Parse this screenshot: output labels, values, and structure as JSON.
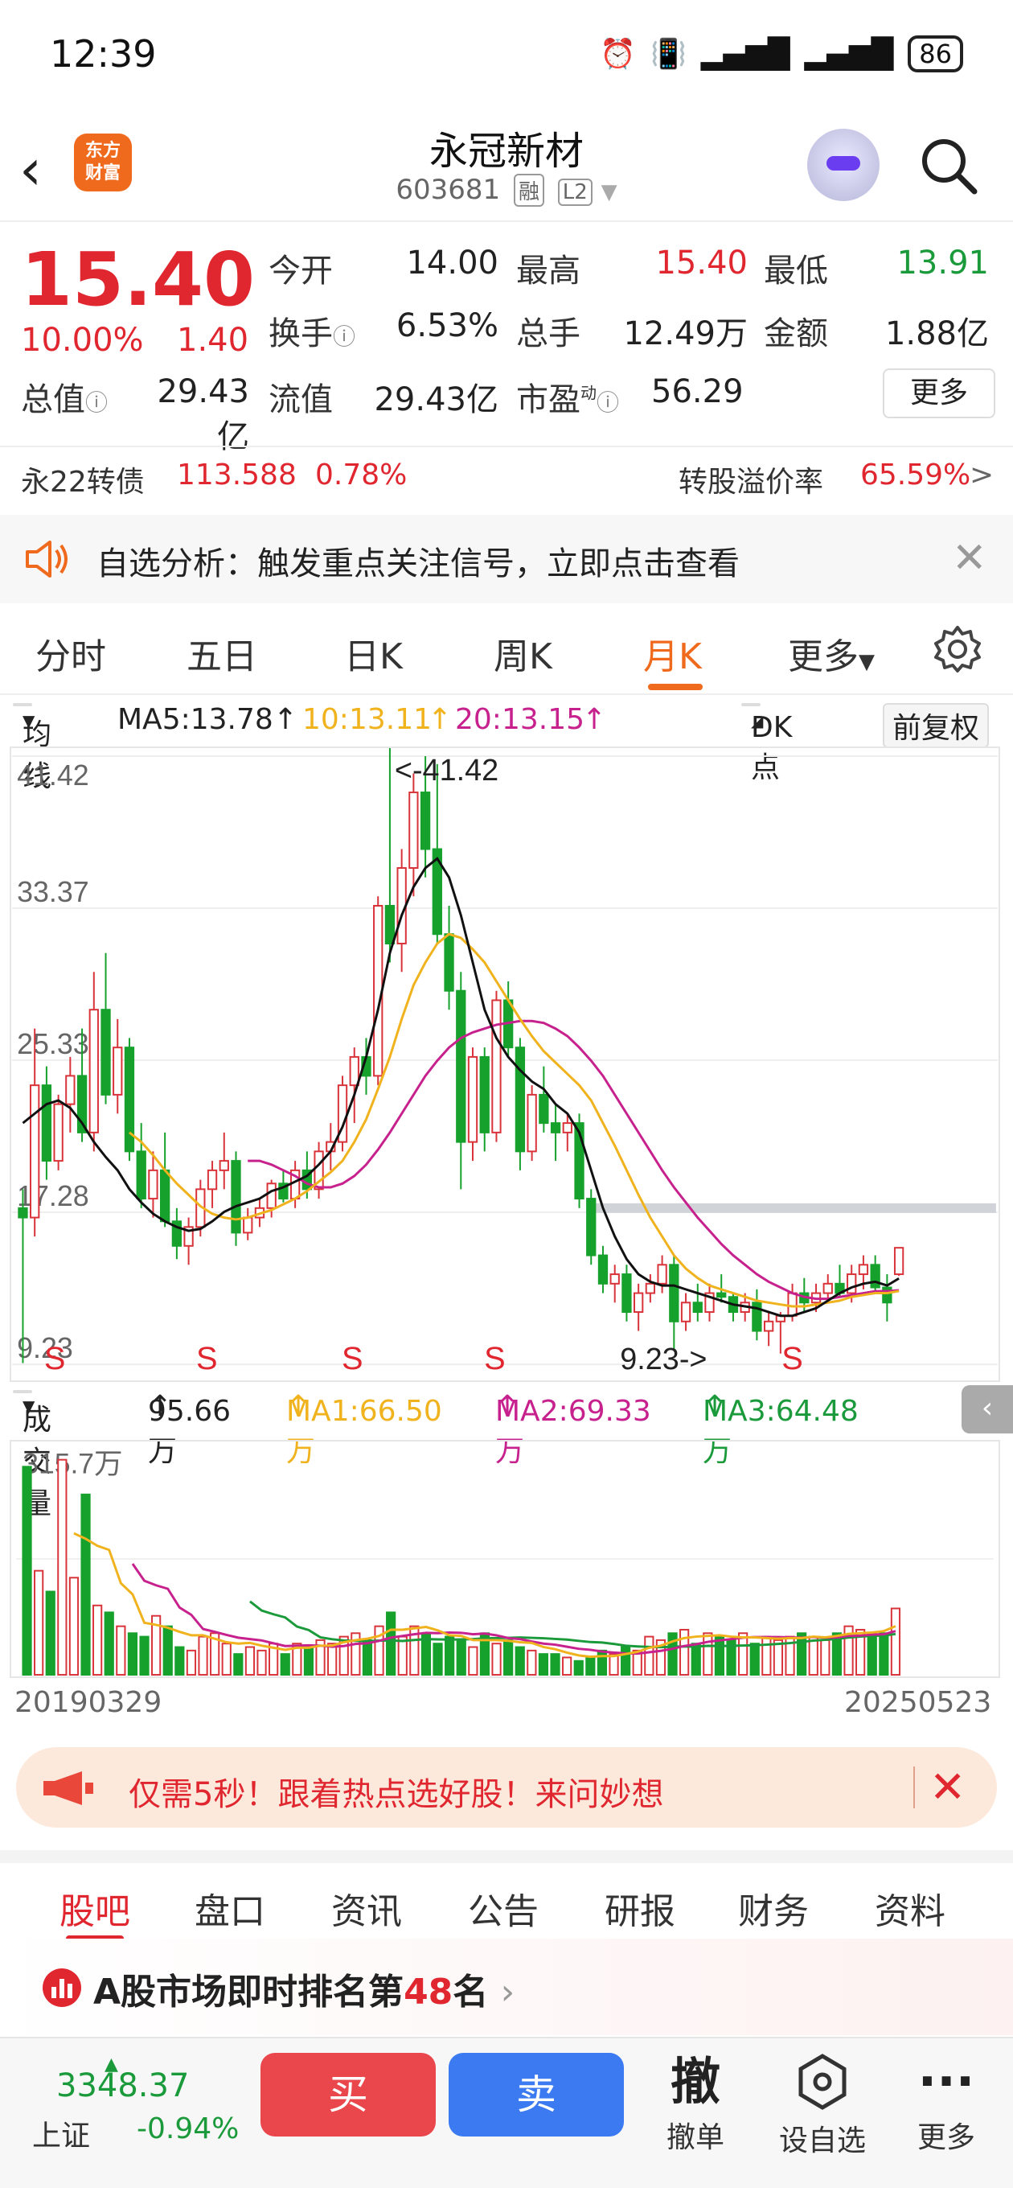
{
  "status": {
    "time": "12:39",
    "battery": "86"
  },
  "header": {
    "name": "永冠新材",
    "code": "603681",
    "tag1": "融",
    "tag2": "L2",
    "logo_line1": "东方",
    "logo_line2": "财富"
  },
  "quote": {
    "price": "15.40",
    "pct": "10.00%",
    "chg": "1.40",
    "open_label": "今开",
    "open": "14.00",
    "high_label": "最高",
    "high": "15.40",
    "low_label": "最低",
    "low": "13.91",
    "turnover_label": "换手",
    "turnover": "6.53%",
    "volume_label": "总手",
    "volume": "12.49万",
    "amount_label": "金额",
    "amount": "1.88亿",
    "mcap_label": "总值",
    "mcap": "29.43亿",
    "float_label": "流值",
    "float": "29.43亿",
    "pe_label": "市盈",
    "pe_sup": "动",
    "pe": "56.29",
    "more": "更多"
  },
  "bond": {
    "name": "永22转债",
    "price": "113.588",
    "pct": "0.78%",
    "premium_label": "转股溢价率",
    "premium": "65.59%"
  },
  "alert": {
    "text": "自选分析：触发重点关注信号，立即点击查看"
  },
  "tabs": [
    "分时",
    "五日",
    "日K",
    "周K",
    "月K",
    "更多"
  ],
  "ma": {
    "selector": "均线",
    "ma5": "MA5:13.78",
    "ma10": "10:13.11",
    "ma20": "20:13.15",
    "dk": "DK点",
    "fq": "前复权"
  },
  "chart_data": {
    "type": "candlestick",
    "y_ticks": [
      "41.42",
      "33.37",
      "25.33",
      "17.28",
      "9.23"
    ],
    "ylim": [
      9.23,
      41.42
    ],
    "annotation_high": "<-41.42",
    "annotation_low": "9.23->",
    "signal_label": "S",
    "candles": [
      [
        17.5,
        18.5,
        9.3,
        17.0
      ],
      [
        17.0,
        27.0,
        16.0,
        24.0
      ],
      [
        24.0,
        25.0,
        19.0,
        20.0
      ],
      [
        20.0,
        23.5,
        19.5,
        23.0
      ],
      [
        23.0,
        25.5,
        21.5,
        24.5
      ],
      [
        24.5,
        27.0,
        21.0,
        21.5
      ],
      [
        21.5,
        30.0,
        20.5,
        28.0
      ],
      [
        28.0,
        31.0,
        23.0,
        23.5
      ],
      [
        23.5,
        27.5,
        22.5,
        26.0
      ],
      [
        26.0,
        26.5,
        20.0,
        20.5
      ],
      [
        20.5,
        22.0,
        17.5,
        18.0
      ],
      [
        18.0,
        20.5,
        17.0,
        19.5
      ],
      [
        19.5,
        21.5,
        16.5,
        16.8
      ],
      [
        16.8,
        17.5,
        14.8,
        15.5
      ],
      [
        15.5,
        17.0,
        14.5,
        16.5
      ],
      [
        16.5,
        19.0,
        16.0,
        18.5
      ],
      [
        18.5,
        20.0,
        17.5,
        19.5
      ],
      [
        19.5,
        21.5,
        18.5,
        20.0
      ],
      [
        20.0,
        20.5,
        15.5,
        16.2
      ],
      [
        16.2,
        17.5,
        15.8,
        17.0
      ],
      [
        17.0,
        18.0,
        16.5,
        17.5
      ],
      [
        17.5,
        19.0,
        17.0,
        18.8
      ],
      [
        18.8,
        19.5,
        17.8,
        18.0
      ],
      [
        18.0,
        20.0,
        17.5,
        19.5
      ],
      [
        19.5,
        20.5,
        18.0,
        18.5
      ],
      [
        18.5,
        21.0,
        18.0,
        20.5
      ],
      [
        20.5,
        22.0,
        19.5,
        21.0
      ],
      [
        21.0,
        24.5,
        20.5,
        24.0
      ],
      [
        24.0,
        26.0,
        22.0,
        25.5
      ],
      [
        25.5,
        26.5,
        23.5,
        24.5
      ],
      [
        24.5,
        34.0,
        24.0,
        33.5
      ],
      [
        33.5,
        42.0,
        30.5,
        31.5
      ],
      [
        31.5,
        36.5,
        30.0,
        35.5
      ],
      [
        35.5,
        40.5,
        34.0,
        39.5
      ],
      [
        39.5,
        41.42,
        35.0,
        36.5
      ],
      [
        36.5,
        41.0,
        31.5,
        32.0
      ],
      [
        32.0,
        33.5,
        28.0,
        29.0
      ],
      [
        29.0,
        30.0,
        18.5,
        21.0
      ],
      [
        21.0,
        26.0,
        20.0,
        25.5
      ],
      [
        25.5,
        26.0,
        20.5,
        21.5
      ],
      [
        21.5,
        29.0,
        21.0,
        28.5
      ],
      [
        28.5,
        29.5,
        25.5,
        26.0
      ],
      [
        26.0,
        26.5,
        19.5,
        20.5
      ],
      [
        20.5,
        24.0,
        20.0,
        23.5
      ],
      [
        23.5,
        25.0,
        21.5,
        22.0
      ],
      [
        22.0,
        23.0,
        20.0,
        21.5
      ],
      [
        21.5,
        22.5,
        20.5,
        22.0
      ],
      [
        22.0,
        22.5,
        17.5,
        18.0
      ],
      [
        18.0,
        18.5,
        14.5,
        15.0
      ],
      [
        15.0,
        15.5,
        13.0,
        13.5
      ],
      [
        13.5,
        14.5,
        12.5,
        14.0
      ],
      [
        14.0,
        14.5,
        11.5,
        12.0
      ],
      [
        12.0,
        13.5,
        11.0,
        13.0
      ],
      [
        13.0,
        14.0,
        12.5,
        13.5
      ],
      [
        13.5,
        15.0,
        13.0,
        14.5
      ],
      [
        14.5,
        15.0,
        10.0,
        11.5
      ],
      [
        11.5,
        13.0,
        11.0,
        12.5
      ],
      [
        12.5,
        13.5,
        11.5,
        12.0
      ],
      [
        12.0,
        13.5,
        11.5,
        13.0
      ],
      [
        13.0,
        14.0,
        12.5,
        12.8
      ],
      [
        12.8,
        13.0,
        11.5,
        12.0
      ],
      [
        12.0,
        13.0,
        11.5,
        12.5
      ],
      [
        12.5,
        13.2,
        10.5,
        11.0
      ],
      [
        11.0,
        12.0,
        10.2,
        11.5
      ],
      [
        11.5,
        12.0,
        9.8,
        11.8
      ],
      [
        11.8,
        13.5,
        11.5,
        13.0
      ],
      [
        13.0,
        13.8,
        12.0,
        12.5
      ],
      [
        12.5,
        13.5,
        12.0,
        13.0
      ],
      [
        13.0,
        14.0,
        12.5,
        13.5
      ],
      [
        13.5,
        14.5,
        12.8,
        13.0
      ],
      [
        13.0,
        14.5,
        12.5,
        14.0
      ],
      [
        14.0,
        15.0,
        13.2,
        14.5
      ],
      [
        14.5,
        15.0,
        13.0,
        13.3
      ],
      [
        13.3,
        14.0,
        11.5,
        12.5
      ],
      [
        14.0,
        15.4,
        13.91,
        15.4
      ]
    ],
    "ma5": [
      22.0,
      22.5,
      23.0,
      23.2,
      22.8,
      22.0,
      21.0,
      20.2,
      19.5,
      18.5,
      17.8,
      17.2,
      16.8,
      16.5,
      16.3,
      16.4,
      16.8,
      17.3,
      17.6,
      17.8,
      18.0,
      18.4,
      18.6,
      18.9,
      19.2,
      19.8,
      20.5,
      21.8,
      23.5,
      25.5,
      28.0,
      31.0,
      33.0,
      34.5,
      35.5,
      36.0,
      35.0,
      33.0,
      30.5,
      28.0,
      26.5,
      25.5,
      24.8,
      24.2,
      23.8,
      23.0,
      22.5,
      21.5,
      19.5,
      17.5,
      16.0,
      14.8,
      14.0,
      13.6,
      13.4,
      13.4,
      13.2,
      13.0,
      12.8,
      12.6,
      12.4,
      12.3,
      12.2,
      12.0,
      11.8,
      11.8,
      12.0,
      12.2,
      12.6,
      13.0,
      13.3,
      13.5,
      13.6,
      13.4,
      13.78
    ],
    "ma10": [
      null,
      null,
      null,
      null,
      null,
      null,
      null,
      null,
      null,
      21.5,
      21.0,
      20.3,
      19.5,
      18.8,
      18.2,
      17.6,
      17.2,
      17.0,
      16.9,
      17.0,
      17.2,
      17.4,
      17.7,
      18.0,
      18.4,
      18.9,
      19.4,
      20.0,
      21.0,
      22.2,
      23.8,
      25.5,
      27.5,
      29.3,
      30.5,
      31.5,
      32.0,
      31.8,
      31.2,
      30.5,
      29.5,
      28.5,
      27.5,
      26.6,
      25.8,
      25.2,
      24.6,
      24.0,
      23.2,
      22.0,
      20.8,
      19.5,
      18.2,
      17.0,
      16.0,
      15.0,
      14.3,
      13.8,
      13.4,
      13.2,
      13.0,
      12.8,
      12.6,
      12.5,
      12.4,
      12.3,
      12.3,
      12.4,
      12.5,
      12.6,
      12.8,
      12.9,
      13.0,
      13.0,
      13.11
    ],
    "ma20": [
      null,
      null,
      null,
      null,
      null,
      null,
      null,
      null,
      null,
      null,
      null,
      null,
      null,
      null,
      null,
      null,
      null,
      null,
      null,
      20.0,
      20.0,
      19.8,
      19.5,
      19.2,
      18.8,
      18.6,
      18.6,
      18.8,
      19.2,
      19.8,
      20.6,
      21.5,
      22.5,
      23.5,
      24.5,
      25.3,
      26.0,
      26.5,
      26.8,
      27.0,
      27.2,
      27.3,
      27.4,
      27.4,
      27.3,
      27.0,
      26.6,
      26.0,
      25.3,
      24.5,
      23.5,
      22.5,
      21.5,
      20.5,
      19.5,
      18.6,
      17.8,
      17.0,
      16.3,
      15.6,
      15.0,
      14.5,
      14.0,
      13.6,
      13.3,
      13.0,
      12.8,
      12.7,
      12.7,
      12.8,
      12.9,
      13.0,
      13.1,
      13.1,
      13.15
    ]
  },
  "volume": {
    "selector": "成交量",
    "current": "95.66万",
    "ma1": "MA1:66.50万",
    "ma2": "MA2:69.33万",
    "ma3": "MA3:64.48万",
    "top_tick": "315.7万",
    "max": 315.7,
    "values": [
      300,
      150,
      120,
      310,
      140,
      260,
      100,
      90,
      70,
      60,
      55,
      85,
      70,
      40,
      35,
      55,
      60,
      45,
      30,
      40,
      35,
      45,
      30,
      45,
      40,
      50,
      45,
      55,
      60,
      50,
      70,
      90,
      55,
      70,
      60,
      45,
      55,
      50,
      40,
      60,
      45,
      50,
      40,
      35,
      30,
      30,
      25,
      20,
      25,
      35,
      30,
      40,
      35,
      55,
      50,
      60,
      65,
      45,
      60,
      55,
      50,
      60,
      45,
      55,
      50,
      55,
      60,
      55,
      50,
      60,
      70,
      65,
      60,
      60,
      95.66
    ]
  },
  "dates": {
    "start": "20190329",
    "end": "20250523"
  },
  "promo": {
    "text": "仅需5秒！跟着热点选好股！来问妙想"
  },
  "ftabs": [
    "股吧",
    "盘口",
    "资讯",
    "公告",
    "研报",
    "财务",
    "资料"
  ],
  "rank": {
    "prefix": "A股市场即时排名第",
    "num": "48",
    "suffix": "名"
  },
  "bottom": {
    "index_val": "3348.37",
    "index_name": "上证",
    "index_chg": "-0.94%",
    "buy": "买",
    "sell": "卖",
    "cancel_big": "撤",
    "cancel": "撤单",
    "watch": "设自选",
    "more": "更多"
  }
}
